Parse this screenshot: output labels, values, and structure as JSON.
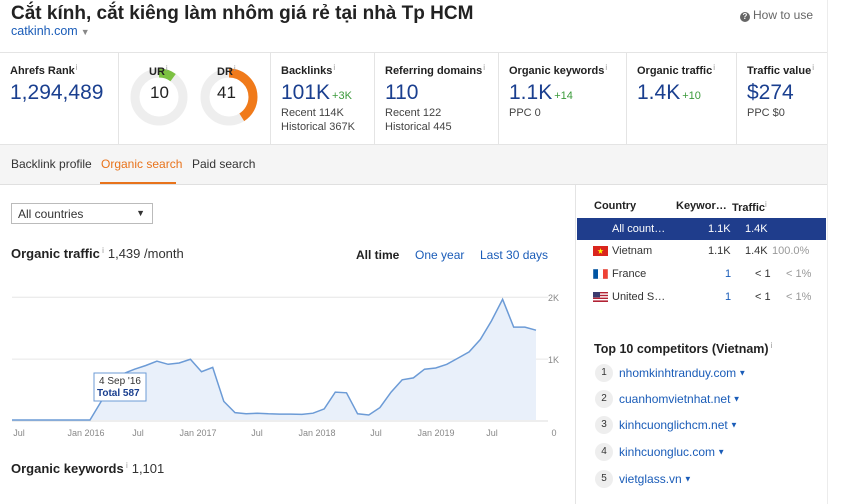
{
  "header": {
    "title": "Cắt kính, cắt kiêng làm nhôm giá rẻ tại nhà Tp HCM",
    "domain": "catkinh.com",
    "how_to_use": "How to use"
  },
  "metrics": {
    "ahrefs_rank": {
      "label": "Ahrefs Rank",
      "value": "1,294,489"
    },
    "ur": {
      "label": "UR",
      "value": "10",
      "gauge": 0.1,
      "color": "#7cc142"
    },
    "dr": {
      "label": "DR",
      "value": "41",
      "gauge": 0.41,
      "color": "#f07a1a"
    },
    "backlinks": {
      "label": "Backlinks",
      "value": "101K",
      "delta": "+3K",
      "recent": "Recent 114K",
      "historical": "Historical 367K"
    },
    "referring_domains": {
      "label": "Referring domains",
      "value": "110",
      "recent": "Recent 122",
      "historical": "Historical 445"
    },
    "organic_keywords": {
      "label": "Organic keywords",
      "value": "1.1K",
      "delta": "+14",
      "sub": "PPC 0"
    },
    "organic_traffic": {
      "label": "Organic traffic",
      "value": "1.4K",
      "delta": "+10"
    },
    "traffic_value": {
      "label": "Traffic value",
      "value": "$274",
      "sub": "PPC $0"
    }
  },
  "tabs": [
    "Backlink profile",
    "Organic search",
    "Paid search"
  ],
  "filter": {
    "selected": "All countries"
  },
  "organic_traffic_section": {
    "title": "Organic traffic",
    "value": "1,439 /month",
    "ranges": [
      "All time",
      "One year",
      "Last 30 days"
    ],
    "tooltip_date": "4 Sep '16",
    "tooltip_total": "Total 587"
  },
  "organic_keywords_section": {
    "title": "Organic keywords",
    "value": "1,101"
  },
  "country_table": {
    "headers": [
      "Country",
      "Keywor…",
      "Traffic"
    ],
    "rows": [
      {
        "country": "All count…",
        "keywords": "1.1K",
        "traffic": "1.4K",
        "share": ""
      },
      {
        "country": "Vietnam",
        "keywords": "1.1K",
        "traffic": "1.4K",
        "share": "100.0%"
      },
      {
        "country": "France",
        "keywords": "1",
        "traffic": "< 1",
        "share": "< 1%"
      },
      {
        "country": "United S…",
        "keywords": "1",
        "traffic": "< 1",
        "share": "< 1%"
      }
    ]
  },
  "competitors": {
    "title": "Top 10 competitors (Vietnam)",
    "items": [
      "nhomkinhtranduy.com",
      "cuanhomvietnhat.net",
      "kinhcuonglichcm.net",
      "kinhcuongluc.com",
      "vietglass.vn"
    ]
  },
  "chart_data": {
    "type": "area",
    "title": "",
    "xlabel": "",
    "ylabel": "",
    "x_ticks": [
      "Jul",
      "Jan 2016",
      "Jul",
      "Jan 2017",
      "Jul",
      "Jan 2018",
      "Jul",
      "Jan 2019",
      "Jul",
      "0"
    ],
    "y_ticks": [
      "2K",
      "1K"
    ],
    "ylim": [
      0,
      2100
    ],
    "x": [
      "2015-05",
      "2015-07",
      "2015-09",
      "2015-11",
      "2016-01",
      "2016-03",
      "2016-05",
      "2016-07",
      "2016-08",
      "2016-09",
      "2016-10",
      "2016-11",
      "2016-12",
      "2017-01",
      "2017-02",
      "2017-03",
      "2017-04",
      "2017-05",
      "2017-06",
      "2017-07",
      "2017-08",
      "2017-09",
      "2017-10",
      "2017-11",
      "2017-12",
      "2018-01",
      "2018-02",
      "2018-03",
      "2018-04",
      "2018-05",
      "2018-06",
      "2018-07",
      "2018-08",
      "2018-09",
      "2018-10",
      "2018-11",
      "2018-12",
      "2019-01",
      "2019-02",
      "2019-03",
      "2019-04",
      "2019-05",
      "2019-06",
      "2019-07",
      "2019-08",
      "2019-09",
      "2019-10",
      "2019-11"
    ],
    "values": [
      0,
      0,
      0,
      0,
      0,
      0,
      0,
      0,
      300,
      587,
      750,
      820,
      880,
      950,
      900,
      920,
      980,
      780,
      850,
      300,
      120,
      100,
      110,
      100,
      95,
      95,
      90,
      110,
      180,
      450,
      440,
      100,
      80,
      200,
      450,
      650,
      680,
      820,
      840,
      900,
      1000,
      1100,
      1300,
      1600,
      1950,
      1500,
      1500,
      1450
    ],
    "color": "#6c9bd6"
  }
}
